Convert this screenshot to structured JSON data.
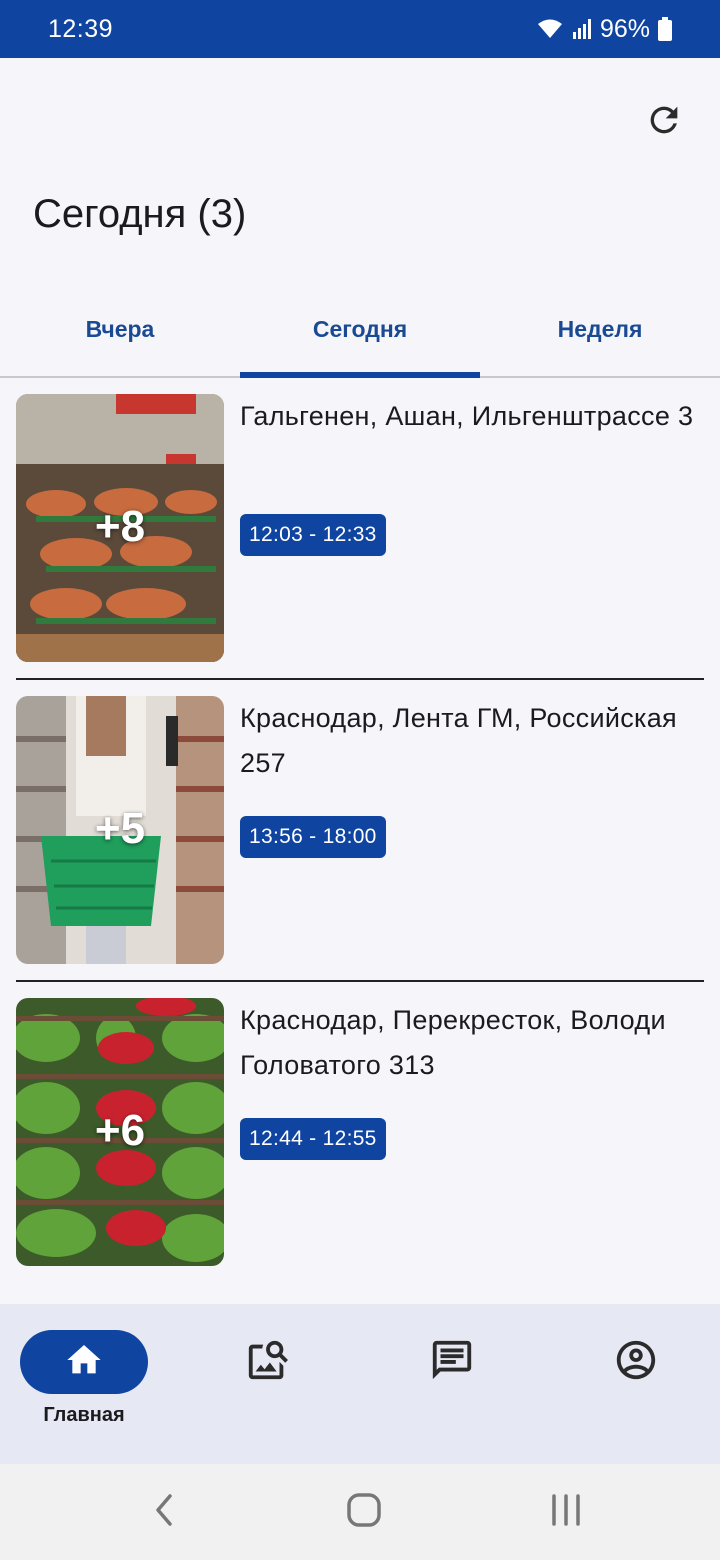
{
  "status_bar": {
    "time": "12:39",
    "battery": "96%"
  },
  "header": {
    "title": "Сегодня (3)",
    "refresh_icon": "refresh-icon"
  },
  "tabs": [
    {
      "label": "Вчера",
      "active": false
    },
    {
      "label": "Сегодня",
      "active": true
    },
    {
      "label": "Неделя",
      "active": false
    }
  ],
  "visits": [
    {
      "address": "Гальгенен, Ашан, Ильгенштрассе 3",
      "time": "12:03 - 12:33",
      "photo_count": "+8",
      "image": "produce-shelves"
    },
    {
      "address": "Краснодар, Лента ГМ, Российская 257",
      "time": "13:56 - 18:00",
      "photo_count": "+5",
      "image": "shopper-basket"
    },
    {
      "address": "Краснодар, Перекресток, Володи Головатого 313",
      "time": "12:44 - 12:55",
      "photo_count": "+6",
      "image": "vegetable-rack"
    }
  ],
  "bottom_nav": [
    {
      "label": "Главная",
      "icon": "home-icon",
      "active": true
    },
    {
      "label": "",
      "icon": "image-search-icon",
      "active": false
    },
    {
      "label": "",
      "icon": "chat-icon",
      "active": false
    },
    {
      "label": "",
      "icon": "account-icon",
      "active": false
    }
  ],
  "colors": {
    "primary": "#0f45a0",
    "background": "#f6f6fa",
    "nav_background": "#e6e8f4"
  }
}
